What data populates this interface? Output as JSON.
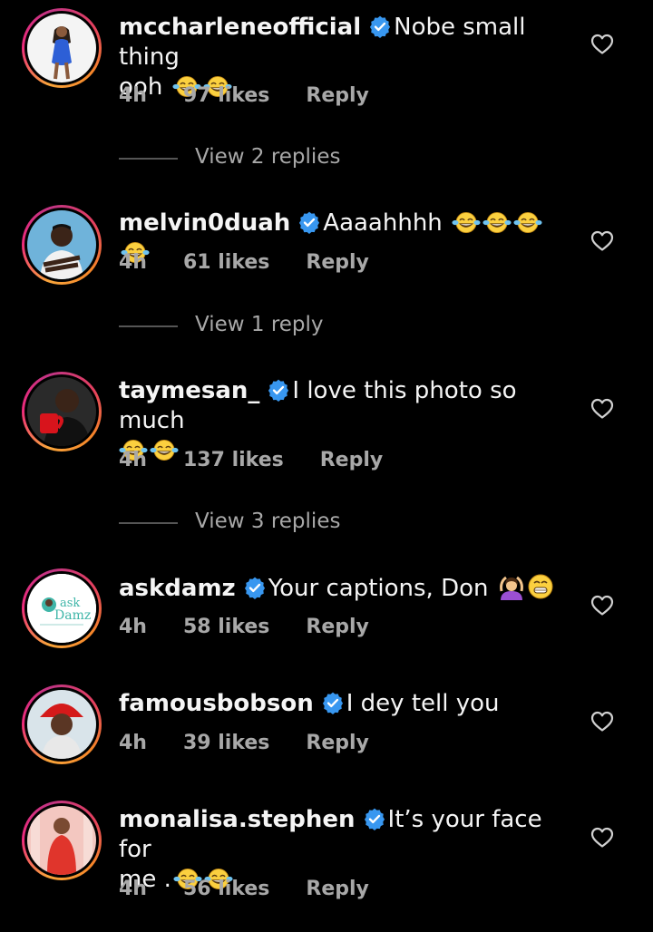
{
  "comments": [
    {
      "username": "mccharleneofficial",
      "text_line1": "Nobe small thing",
      "text_line2": "ooh",
      "time": "4h",
      "likes": "97 likes",
      "reply": "Reply",
      "view_replies": "View 2 replies"
    },
    {
      "username": "melvin0duah",
      "text_line1": "Aaaahhhh",
      "time": "4h",
      "likes": "61 likes",
      "reply": "Reply",
      "view_replies": "View 1 reply"
    },
    {
      "username": "taymesan_",
      "text_line1": "I love this photo so much",
      "time": "4h",
      "likes": "137 likes",
      "reply": "Reply",
      "view_replies": "View 3 replies"
    },
    {
      "username": "askdamz",
      "text_line1": "Your captions, Don",
      "time": "4h",
      "likes": "58 likes",
      "reply": "Reply",
      "avatar_text_1": "ask",
      "avatar_text_2": "Damz"
    },
    {
      "username": "famousbobson",
      "text_line1": "I dey tell you",
      "time": "4h",
      "likes": "39 likes",
      "reply": "Reply"
    },
    {
      "username": "monalisa.stephen",
      "text_line1": "It’s your face for",
      "text_line2": "me .",
      "time": "4h",
      "likes": "56 likes",
      "reply": "Reply"
    }
  ],
  "icons": {
    "verified": "verified-badge-icon",
    "like": "heart-outline-icon",
    "laugh_emoji": "face-with-tears-of-joy",
    "person_emoji": "person-gesturing-ok",
    "grin_emoji": "grinning-face"
  },
  "colors": {
    "background": "#000000",
    "text": "#f5f5f5",
    "meta": "#a8a8a8",
    "verified": "#3897f0"
  }
}
